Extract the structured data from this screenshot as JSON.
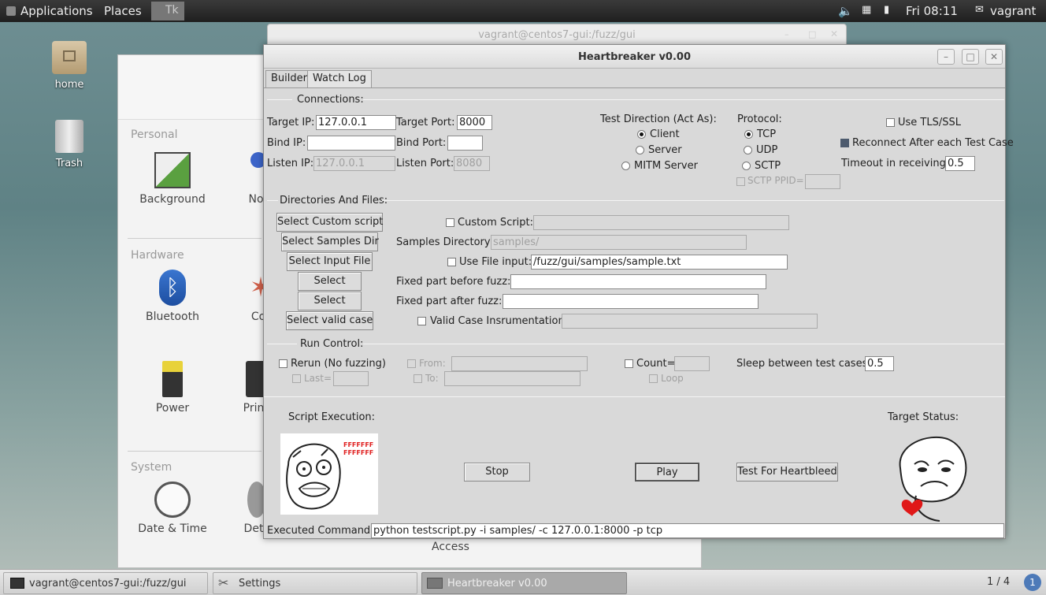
{
  "topbar": {
    "applications": "Applications",
    "places": "Places",
    "tk_label": "Tk",
    "clock": "Fri 08:11",
    "user": "vagrant"
  },
  "desktop": {
    "home": "home",
    "trash": "Trash"
  },
  "settings_window": {
    "personal": "Personal",
    "hardware": "Hardware",
    "system": "System",
    "items": [
      "Background",
      "Notific",
      "Bluetooth",
      "Co",
      "Power",
      "Prin",
      "Date & Time",
      "Det",
      "Access"
    ]
  },
  "terminal_window": {
    "title": "vagrant@centos7-gui:/fuzz/gui"
  },
  "app": {
    "title": "Heartbreaker v0.00",
    "tabs": [
      "Builder",
      "Watch Log"
    ],
    "connections": {
      "section": "Connections:",
      "target_ip_label": "Target IP:",
      "target_ip": "127.0.0.1",
      "target_port_label": "Target Port:",
      "target_port": "8000",
      "bind_ip_label": "Bind IP:",
      "bind_ip": "",
      "bind_port_label": "Bind Port:",
      "bind_port": "",
      "listen_ip_label": "Listen IP:",
      "listen_ip": "127.0.0.1",
      "listen_port_label": "Listen Port:",
      "listen_port": "8080",
      "direction_label": "Test Direction (Act As):",
      "direction_options": [
        "Client",
        "Server",
        "MITM Server"
      ],
      "direction_selected": "Client",
      "protocol_label": "Protocol:",
      "protocol_options": [
        "TCP",
        "UDP",
        "SCTP"
      ],
      "protocol_selected": "TCP",
      "sctp_ppid_label": "SCTP PPID=",
      "use_tls_label": "Use TLS/SSL",
      "reconnect_label": "Reconnect After each Test Case",
      "timeout_label": "Timeout in receiving:",
      "timeout": "0.5"
    },
    "files": {
      "section": "Directories And Files:",
      "select_custom_script": "Select Custom script",
      "custom_script_label": "Custom Script:",
      "select_samples_dir": "Select Samples Dir",
      "samples_dir_label": "Samples Directory:",
      "samples_dir": "samples/",
      "select_input_file": "Select Input File",
      "use_file_input_label": "Use File input:",
      "file_input": "/fuzz/gui/samples/sample.txt",
      "select_before": "Select",
      "fixed_before_label": "Fixed part before fuzz:",
      "select_after": "Select",
      "fixed_after_label": "Fixed part after fuzz:",
      "select_valid_case": "Select valid case",
      "valid_case_label": "Valid Case Insrumentation:"
    },
    "run_control": {
      "section": "Run Control:",
      "rerun_label": "Rerun (No fuzzing)",
      "last_label": "Last=",
      "from_label": "From:",
      "to_label": "To:",
      "count_label": "Count=",
      "loop_label": "Loop",
      "sleep_label": "Sleep between test cases:",
      "sleep": "0.5"
    },
    "execution": {
      "script_execution_label": "Script Execution:",
      "rage_text": "FFFFFFF\nFFFFFFF",
      "stop": "Stop",
      "play": "Play",
      "heartbleed": "Test For Heartbleed",
      "target_status_label": "Target Status:",
      "executed_command_label": "Executed Command:",
      "executed_command": "python testscript.py -i samples/ -c 127.0.0.1:8000 -p tcp"
    }
  },
  "taskbar": {
    "terminal": "vagrant@centos7-gui:/fuzz/gui",
    "settings": "Settings",
    "heartbreaker": "Heartbreaker v0.00",
    "workspace": "1 / 4",
    "notifications": "1"
  }
}
